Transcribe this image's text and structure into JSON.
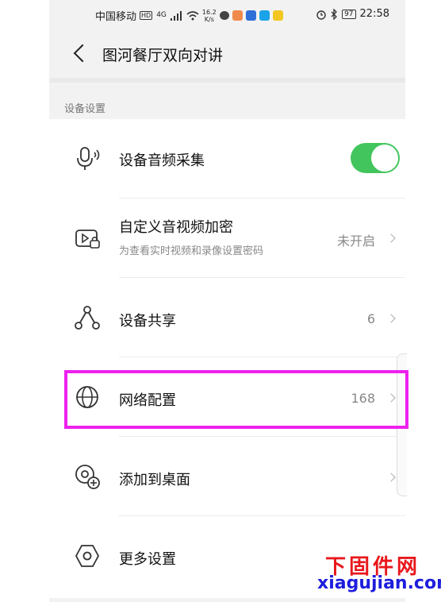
{
  "status_bar": {
    "carrier": "中国移动",
    "hd": "HD",
    "network": "4G",
    "speed_value": "16.2",
    "speed_unit": "K/s",
    "battery": "97",
    "time": "22:58"
  },
  "header": {
    "title": "图河餐厅双向对讲"
  },
  "section": {
    "label": "设备设置"
  },
  "rows": [
    {
      "label": "设备音频采集",
      "toggle_on": true,
      "icon": "microphone-icon"
    },
    {
      "label": "自定义音视频加密",
      "subtitle": "为查看实时视频和录像设置密码",
      "value": "未开启",
      "icon": "video-lock-icon"
    },
    {
      "label": "设备共享",
      "value": "6",
      "icon": "share-nodes-icon"
    },
    {
      "label": "网络配置",
      "value": "168",
      "icon": "globe-icon"
    },
    {
      "label": "添加到桌面",
      "value": "",
      "icon": "add-to-desktop-icon"
    },
    {
      "label": "更多设置",
      "icon": "hexagon-settings-icon"
    }
  ],
  "watermark": {
    "title": "下固件网",
    "url": "xiagujian.com"
  },
  "colors": {
    "toggle_on": "#43c55d",
    "highlight": "#ee22ee",
    "watermark_title": "#e8171c",
    "watermark_url": "#1d1ddd"
  }
}
